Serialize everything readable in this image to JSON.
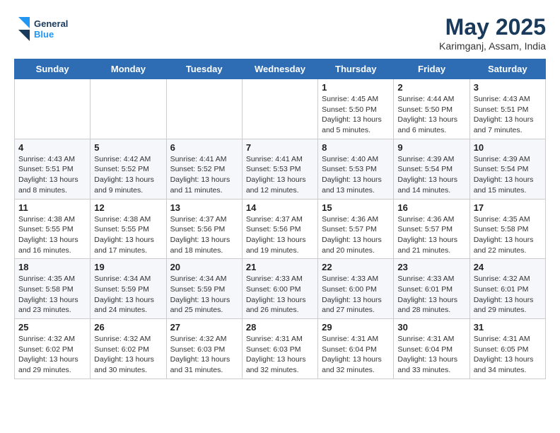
{
  "header": {
    "logo_line1": "General",
    "logo_line2": "Blue",
    "month_year": "May 2025",
    "location": "Karimganj, Assam, India"
  },
  "days_of_week": [
    "Sunday",
    "Monday",
    "Tuesday",
    "Wednesday",
    "Thursday",
    "Friday",
    "Saturday"
  ],
  "weeks": [
    [
      {
        "day": "",
        "info": ""
      },
      {
        "day": "",
        "info": ""
      },
      {
        "day": "",
        "info": ""
      },
      {
        "day": "",
        "info": ""
      },
      {
        "day": "1",
        "info": "Sunrise: 4:45 AM\nSunset: 5:50 PM\nDaylight: 13 hours\nand 5 minutes."
      },
      {
        "day": "2",
        "info": "Sunrise: 4:44 AM\nSunset: 5:50 PM\nDaylight: 13 hours\nand 6 minutes."
      },
      {
        "day": "3",
        "info": "Sunrise: 4:43 AM\nSunset: 5:51 PM\nDaylight: 13 hours\nand 7 minutes."
      }
    ],
    [
      {
        "day": "4",
        "info": "Sunrise: 4:43 AM\nSunset: 5:51 PM\nDaylight: 13 hours\nand 8 minutes."
      },
      {
        "day": "5",
        "info": "Sunrise: 4:42 AM\nSunset: 5:52 PM\nDaylight: 13 hours\nand 9 minutes."
      },
      {
        "day": "6",
        "info": "Sunrise: 4:41 AM\nSunset: 5:52 PM\nDaylight: 13 hours\nand 11 minutes."
      },
      {
        "day": "7",
        "info": "Sunrise: 4:41 AM\nSunset: 5:53 PM\nDaylight: 13 hours\nand 12 minutes."
      },
      {
        "day": "8",
        "info": "Sunrise: 4:40 AM\nSunset: 5:53 PM\nDaylight: 13 hours\nand 13 minutes."
      },
      {
        "day": "9",
        "info": "Sunrise: 4:39 AM\nSunset: 5:54 PM\nDaylight: 13 hours\nand 14 minutes."
      },
      {
        "day": "10",
        "info": "Sunrise: 4:39 AM\nSunset: 5:54 PM\nDaylight: 13 hours\nand 15 minutes."
      }
    ],
    [
      {
        "day": "11",
        "info": "Sunrise: 4:38 AM\nSunset: 5:55 PM\nDaylight: 13 hours\nand 16 minutes."
      },
      {
        "day": "12",
        "info": "Sunrise: 4:38 AM\nSunset: 5:55 PM\nDaylight: 13 hours\nand 17 minutes."
      },
      {
        "day": "13",
        "info": "Sunrise: 4:37 AM\nSunset: 5:56 PM\nDaylight: 13 hours\nand 18 minutes."
      },
      {
        "day": "14",
        "info": "Sunrise: 4:37 AM\nSunset: 5:56 PM\nDaylight: 13 hours\nand 19 minutes."
      },
      {
        "day": "15",
        "info": "Sunrise: 4:36 AM\nSunset: 5:57 PM\nDaylight: 13 hours\nand 20 minutes."
      },
      {
        "day": "16",
        "info": "Sunrise: 4:36 AM\nSunset: 5:57 PM\nDaylight: 13 hours\nand 21 minutes."
      },
      {
        "day": "17",
        "info": "Sunrise: 4:35 AM\nSunset: 5:58 PM\nDaylight: 13 hours\nand 22 minutes."
      }
    ],
    [
      {
        "day": "18",
        "info": "Sunrise: 4:35 AM\nSunset: 5:58 PM\nDaylight: 13 hours\nand 23 minutes."
      },
      {
        "day": "19",
        "info": "Sunrise: 4:34 AM\nSunset: 5:59 PM\nDaylight: 13 hours\nand 24 minutes."
      },
      {
        "day": "20",
        "info": "Sunrise: 4:34 AM\nSunset: 5:59 PM\nDaylight: 13 hours\nand 25 minutes."
      },
      {
        "day": "21",
        "info": "Sunrise: 4:33 AM\nSunset: 6:00 PM\nDaylight: 13 hours\nand 26 minutes."
      },
      {
        "day": "22",
        "info": "Sunrise: 4:33 AM\nSunset: 6:00 PM\nDaylight: 13 hours\nand 27 minutes."
      },
      {
        "day": "23",
        "info": "Sunrise: 4:33 AM\nSunset: 6:01 PM\nDaylight: 13 hours\nand 28 minutes."
      },
      {
        "day": "24",
        "info": "Sunrise: 4:32 AM\nSunset: 6:01 PM\nDaylight: 13 hours\nand 29 minutes."
      }
    ],
    [
      {
        "day": "25",
        "info": "Sunrise: 4:32 AM\nSunset: 6:02 PM\nDaylight: 13 hours\nand 29 minutes."
      },
      {
        "day": "26",
        "info": "Sunrise: 4:32 AM\nSunset: 6:02 PM\nDaylight: 13 hours\nand 30 minutes."
      },
      {
        "day": "27",
        "info": "Sunrise: 4:32 AM\nSunset: 6:03 PM\nDaylight: 13 hours\nand 31 minutes."
      },
      {
        "day": "28",
        "info": "Sunrise: 4:31 AM\nSunset: 6:03 PM\nDaylight: 13 hours\nand 32 minutes."
      },
      {
        "day": "29",
        "info": "Sunrise: 4:31 AM\nSunset: 6:04 PM\nDaylight: 13 hours\nand 32 minutes."
      },
      {
        "day": "30",
        "info": "Sunrise: 4:31 AM\nSunset: 6:04 PM\nDaylight: 13 hours\nand 33 minutes."
      },
      {
        "day": "31",
        "info": "Sunrise: 4:31 AM\nSunset: 6:05 PM\nDaylight: 13 hours\nand 34 minutes."
      }
    ]
  ]
}
